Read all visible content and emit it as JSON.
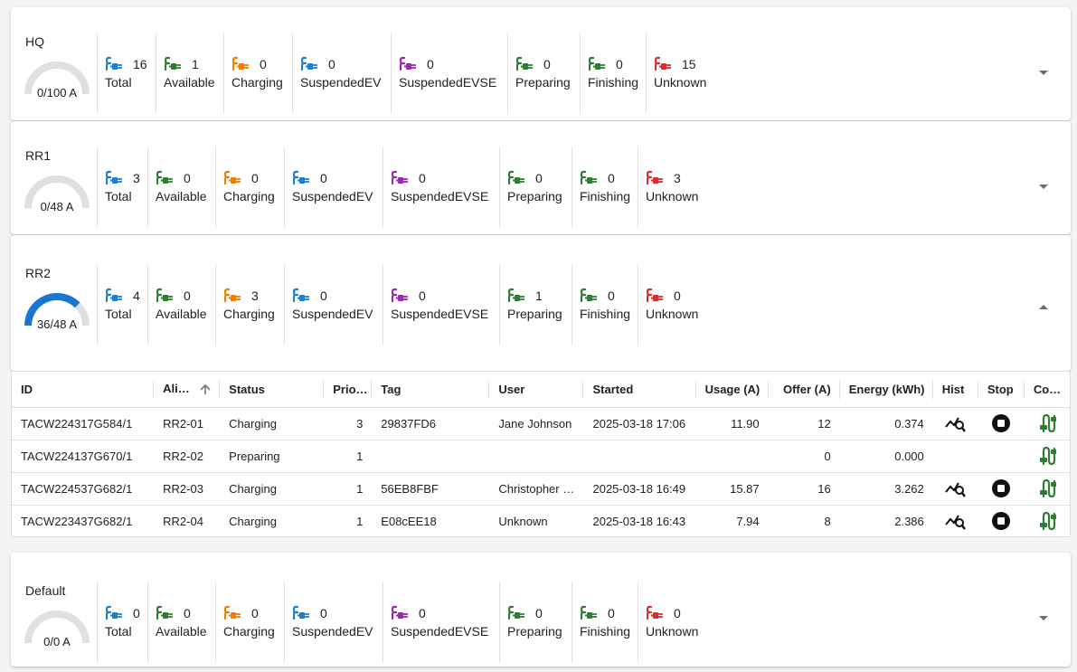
{
  "status_colors": {
    "Total": "#1e7fce",
    "Available": "#2e7d32",
    "Charging": "#ef7d00",
    "SuspendedEV": "#1e7fce",
    "SuspendedEVSE": "#9c27b0",
    "Preparing": "#2e7d32",
    "Finishing": "#2e7d32",
    "Unknown": "#d32f2f"
  },
  "gauge": {
    "track_color": "#e0e0e0",
    "fill_color": "#1976d2"
  },
  "groups": [
    {
      "name": "HQ",
      "gauge_label": "0/100 A",
      "load_fraction": 0.0,
      "expanded": false,
      "stats": [
        {
          "label": "Total",
          "count": "16"
        },
        {
          "label": "Available",
          "count": "1"
        },
        {
          "label": "Charging",
          "count": "0"
        },
        {
          "label": "SuspendedEV",
          "count": "0"
        },
        {
          "label": "SuspendedEVSE",
          "count": "0"
        },
        {
          "label": "Preparing",
          "count": "0"
        },
        {
          "label": "Finishing",
          "count": "0"
        },
        {
          "label": "Unknown",
          "count": "15"
        }
      ]
    },
    {
      "name": "RR1",
      "gauge_label": "0/48 A",
      "load_fraction": 0.0,
      "expanded": false,
      "stats": [
        {
          "label": "Total",
          "count": "3"
        },
        {
          "label": "Available",
          "count": "0"
        },
        {
          "label": "Charging",
          "count": "0"
        },
        {
          "label": "SuspendedEV",
          "count": "0"
        },
        {
          "label": "SuspendedEVSE",
          "count": "0"
        },
        {
          "label": "Preparing",
          "count": "0"
        },
        {
          "label": "Finishing",
          "count": "0"
        },
        {
          "label": "Unknown",
          "count": "3"
        }
      ]
    },
    {
      "name": "RR2",
      "gauge_label": "36/48 A",
      "load_fraction": 0.75,
      "expanded": true,
      "stats": [
        {
          "label": "Total",
          "count": "4"
        },
        {
          "label": "Available",
          "count": "0"
        },
        {
          "label": "Charging",
          "count": "3"
        },
        {
          "label": "SuspendedEV",
          "count": "0"
        },
        {
          "label": "SuspendedEVSE",
          "count": "0"
        },
        {
          "label": "Preparing",
          "count": "1"
        },
        {
          "label": "Finishing",
          "count": "0"
        },
        {
          "label": "Unknown",
          "count": "0"
        }
      ]
    },
    {
      "name": "Default",
      "gauge_label": "0/0 A",
      "load_fraction": 0.0,
      "expanded": false,
      "stats": [
        {
          "label": "Total",
          "count": "0"
        },
        {
          "label": "Available",
          "count": "0"
        },
        {
          "label": "Charging",
          "count": "0"
        },
        {
          "label": "SuspendedEV",
          "count": "0"
        },
        {
          "label": "SuspendedEVSE",
          "count": "0"
        },
        {
          "label": "Preparing",
          "count": "0"
        },
        {
          "label": "Finishing",
          "count": "0"
        },
        {
          "label": "Unknown",
          "count": "0"
        }
      ]
    }
  ],
  "table": {
    "columns": [
      "ID",
      "Ali…",
      "Status",
      "Prio…",
      "Tag",
      "User",
      "Started",
      "Usage (A)",
      "Offer (A)",
      "Energy (kWh)",
      "Hist",
      "Stop",
      "Co…"
    ],
    "sort_column": "Ali…",
    "sort_direction": "ascending",
    "rows": [
      {
        "id": "TACW224317G584/1",
        "alias": "RR2-01",
        "status": "Charging",
        "prio": "3",
        "tag": "29837FD6",
        "user": "Jane Johnson",
        "started": "2025-03-18 17:06",
        "usage": "11.90",
        "offer": "12",
        "energy": "0.374",
        "hist": true,
        "stop": true,
        "connector": true
      },
      {
        "id": "TACW224137G670/1",
        "alias": "RR2-02",
        "status": "Preparing",
        "prio": "1",
        "tag": "",
        "user": "",
        "started": "",
        "usage": "",
        "offer": "0",
        "energy": "0.000",
        "hist": false,
        "stop": false,
        "connector": true
      },
      {
        "id": "TACW224537G682/1",
        "alias": "RR2-03",
        "status": "Charging",
        "prio": "1",
        "tag": "56EB8FBF",
        "user": "Christopher …",
        "started": "2025-03-18 16:49",
        "usage": "15.87",
        "offer": "16",
        "energy": "3.262",
        "hist": true,
        "stop": true,
        "connector": true
      },
      {
        "id": "TACW223437G682/1",
        "alias": "RR2-04",
        "status": "Charging",
        "prio": "1",
        "tag": "E08cEE18",
        "user": "Unknown",
        "started": "2025-03-18 16:43",
        "usage": "7.94",
        "offer": "8",
        "energy": "2.386",
        "hist": true,
        "stop": true,
        "connector": true
      }
    ]
  }
}
